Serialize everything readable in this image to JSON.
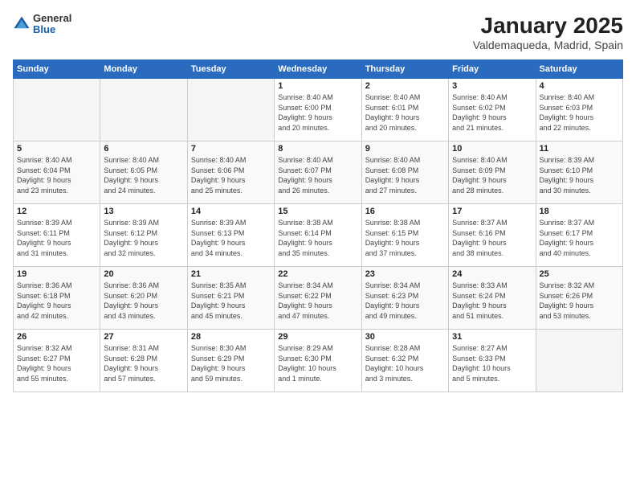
{
  "logo": {
    "general": "General",
    "blue": "Blue"
  },
  "title": "January 2025",
  "subtitle": "Valdemaqueda, Madrid, Spain",
  "weekdays": [
    "Sunday",
    "Monday",
    "Tuesday",
    "Wednesday",
    "Thursday",
    "Friday",
    "Saturday"
  ],
  "weeks": [
    [
      {
        "day": "",
        "info": ""
      },
      {
        "day": "",
        "info": ""
      },
      {
        "day": "",
        "info": ""
      },
      {
        "day": "1",
        "info": "Sunrise: 8:40 AM\nSunset: 6:00 PM\nDaylight: 9 hours\nand 20 minutes."
      },
      {
        "day": "2",
        "info": "Sunrise: 8:40 AM\nSunset: 6:01 PM\nDaylight: 9 hours\nand 20 minutes."
      },
      {
        "day": "3",
        "info": "Sunrise: 8:40 AM\nSunset: 6:02 PM\nDaylight: 9 hours\nand 21 minutes."
      },
      {
        "day": "4",
        "info": "Sunrise: 8:40 AM\nSunset: 6:03 PM\nDaylight: 9 hours\nand 22 minutes."
      }
    ],
    [
      {
        "day": "5",
        "info": "Sunrise: 8:40 AM\nSunset: 6:04 PM\nDaylight: 9 hours\nand 23 minutes."
      },
      {
        "day": "6",
        "info": "Sunrise: 8:40 AM\nSunset: 6:05 PM\nDaylight: 9 hours\nand 24 minutes."
      },
      {
        "day": "7",
        "info": "Sunrise: 8:40 AM\nSunset: 6:06 PM\nDaylight: 9 hours\nand 25 minutes."
      },
      {
        "day": "8",
        "info": "Sunrise: 8:40 AM\nSunset: 6:07 PM\nDaylight: 9 hours\nand 26 minutes."
      },
      {
        "day": "9",
        "info": "Sunrise: 8:40 AM\nSunset: 6:08 PM\nDaylight: 9 hours\nand 27 minutes."
      },
      {
        "day": "10",
        "info": "Sunrise: 8:40 AM\nSunset: 6:09 PM\nDaylight: 9 hours\nand 28 minutes."
      },
      {
        "day": "11",
        "info": "Sunrise: 8:39 AM\nSunset: 6:10 PM\nDaylight: 9 hours\nand 30 minutes."
      }
    ],
    [
      {
        "day": "12",
        "info": "Sunrise: 8:39 AM\nSunset: 6:11 PM\nDaylight: 9 hours\nand 31 minutes."
      },
      {
        "day": "13",
        "info": "Sunrise: 8:39 AM\nSunset: 6:12 PM\nDaylight: 9 hours\nand 32 minutes."
      },
      {
        "day": "14",
        "info": "Sunrise: 8:39 AM\nSunset: 6:13 PM\nDaylight: 9 hours\nand 34 minutes."
      },
      {
        "day": "15",
        "info": "Sunrise: 8:38 AM\nSunset: 6:14 PM\nDaylight: 9 hours\nand 35 minutes."
      },
      {
        "day": "16",
        "info": "Sunrise: 8:38 AM\nSunset: 6:15 PM\nDaylight: 9 hours\nand 37 minutes."
      },
      {
        "day": "17",
        "info": "Sunrise: 8:37 AM\nSunset: 6:16 PM\nDaylight: 9 hours\nand 38 minutes."
      },
      {
        "day": "18",
        "info": "Sunrise: 8:37 AM\nSunset: 6:17 PM\nDaylight: 9 hours\nand 40 minutes."
      }
    ],
    [
      {
        "day": "19",
        "info": "Sunrise: 8:36 AM\nSunset: 6:18 PM\nDaylight: 9 hours\nand 42 minutes."
      },
      {
        "day": "20",
        "info": "Sunrise: 8:36 AM\nSunset: 6:20 PM\nDaylight: 9 hours\nand 43 minutes."
      },
      {
        "day": "21",
        "info": "Sunrise: 8:35 AM\nSunset: 6:21 PM\nDaylight: 9 hours\nand 45 minutes."
      },
      {
        "day": "22",
        "info": "Sunrise: 8:34 AM\nSunset: 6:22 PM\nDaylight: 9 hours\nand 47 minutes."
      },
      {
        "day": "23",
        "info": "Sunrise: 8:34 AM\nSunset: 6:23 PM\nDaylight: 9 hours\nand 49 minutes."
      },
      {
        "day": "24",
        "info": "Sunrise: 8:33 AM\nSunset: 6:24 PM\nDaylight: 9 hours\nand 51 minutes."
      },
      {
        "day": "25",
        "info": "Sunrise: 8:32 AM\nSunset: 6:26 PM\nDaylight: 9 hours\nand 53 minutes."
      }
    ],
    [
      {
        "day": "26",
        "info": "Sunrise: 8:32 AM\nSunset: 6:27 PM\nDaylight: 9 hours\nand 55 minutes."
      },
      {
        "day": "27",
        "info": "Sunrise: 8:31 AM\nSunset: 6:28 PM\nDaylight: 9 hours\nand 57 minutes."
      },
      {
        "day": "28",
        "info": "Sunrise: 8:30 AM\nSunset: 6:29 PM\nDaylight: 9 hours\nand 59 minutes."
      },
      {
        "day": "29",
        "info": "Sunrise: 8:29 AM\nSunset: 6:30 PM\nDaylight: 10 hours\nand 1 minute."
      },
      {
        "day": "30",
        "info": "Sunrise: 8:28 AM\nSunset: 6:32 PM\nDaylight: 10 hours\nand 3 minutes."
      },
      {
        "day": "31",
        "info": "Sunrise: 8:27 AM\nSunset: 6:33 PM\nDaylight: 10 hours\nand 5 minutes."
      },
      {
        "day": "",
        "info": ""
      }
    ]
  ]
}
